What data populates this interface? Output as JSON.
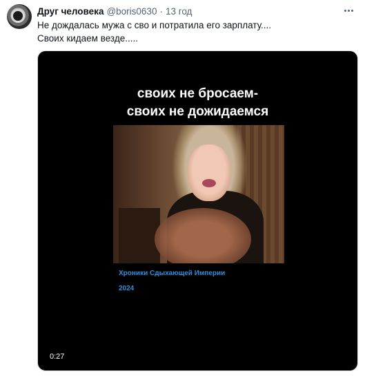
{
  "tweet": {
    "display_name": "Друг человека",
    "handle": "@boris0630",
    "separator": "·",
    "time": "13 год",
    "text_line1": "Не дождалась мужа с сво и потратила его зарплату....",
    "text_line2": "Своих кидаем везде....."
  },
  "media": {
    "caption_line1": "своих не бросаем-",
    "caption_line2": "своих не дожидаемся",
    "brand_line1": "Хроники Сдыхающей Империи",
    "brand_line2": "2024",
    "duration": "0:27"
  },
  "icons": {
    "more": "more-horizontal-icon",
    "avatar": "user-avatar"
  },
  "colors": {
    "text_primary": "#0f1419",
    "text_secondary": "#536471",
    "media_background": "#000000",
    "brand_blue": "#2d8fe0"
  }
}
